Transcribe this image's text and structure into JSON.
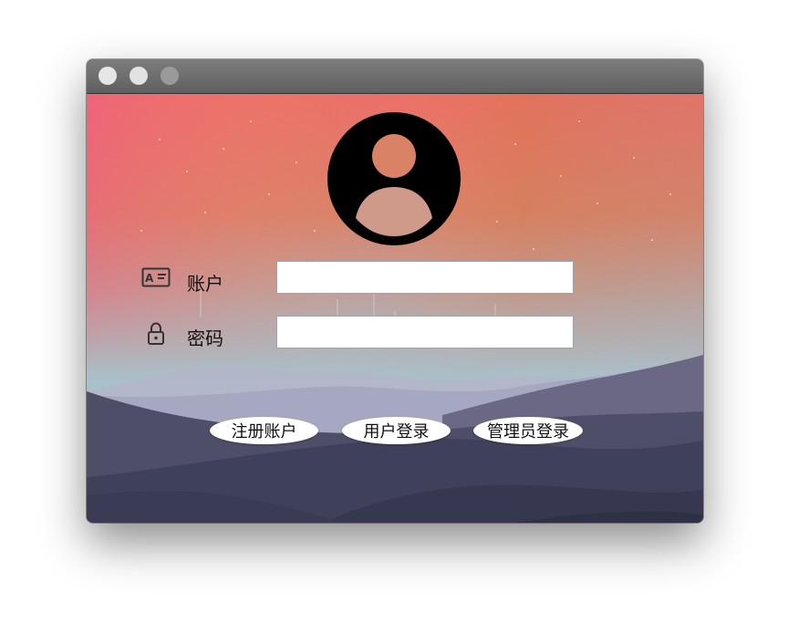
{
  "window": {
    "controls": [
      "close",
      "minimize",
      "zoom"
    ]
  },
  "login": {
    "avatar_icon": "user-circle-icon",
    "account": {
      "label": "账户",
      "icon": "id-card-icon",
      "value": "",
      "placeholder": ""
    },
    "password": {
      "label": "密码",
      "icon": "lock-icon",
      "value": "",
      "placeholder": ""
    }
  },
  "buttons": {
    "register": "注册账户",
    "user_login": "用户登录",
    "admin_login": "管理员登录"
  },
  "colors": {
    "sky_top_left": "#ef6a7e",
    "sky_top_right": "#c98150",
    "sky_bottom": "#a8c2cc",
    "mountain_dark": "#3e3f58"
  }
}
